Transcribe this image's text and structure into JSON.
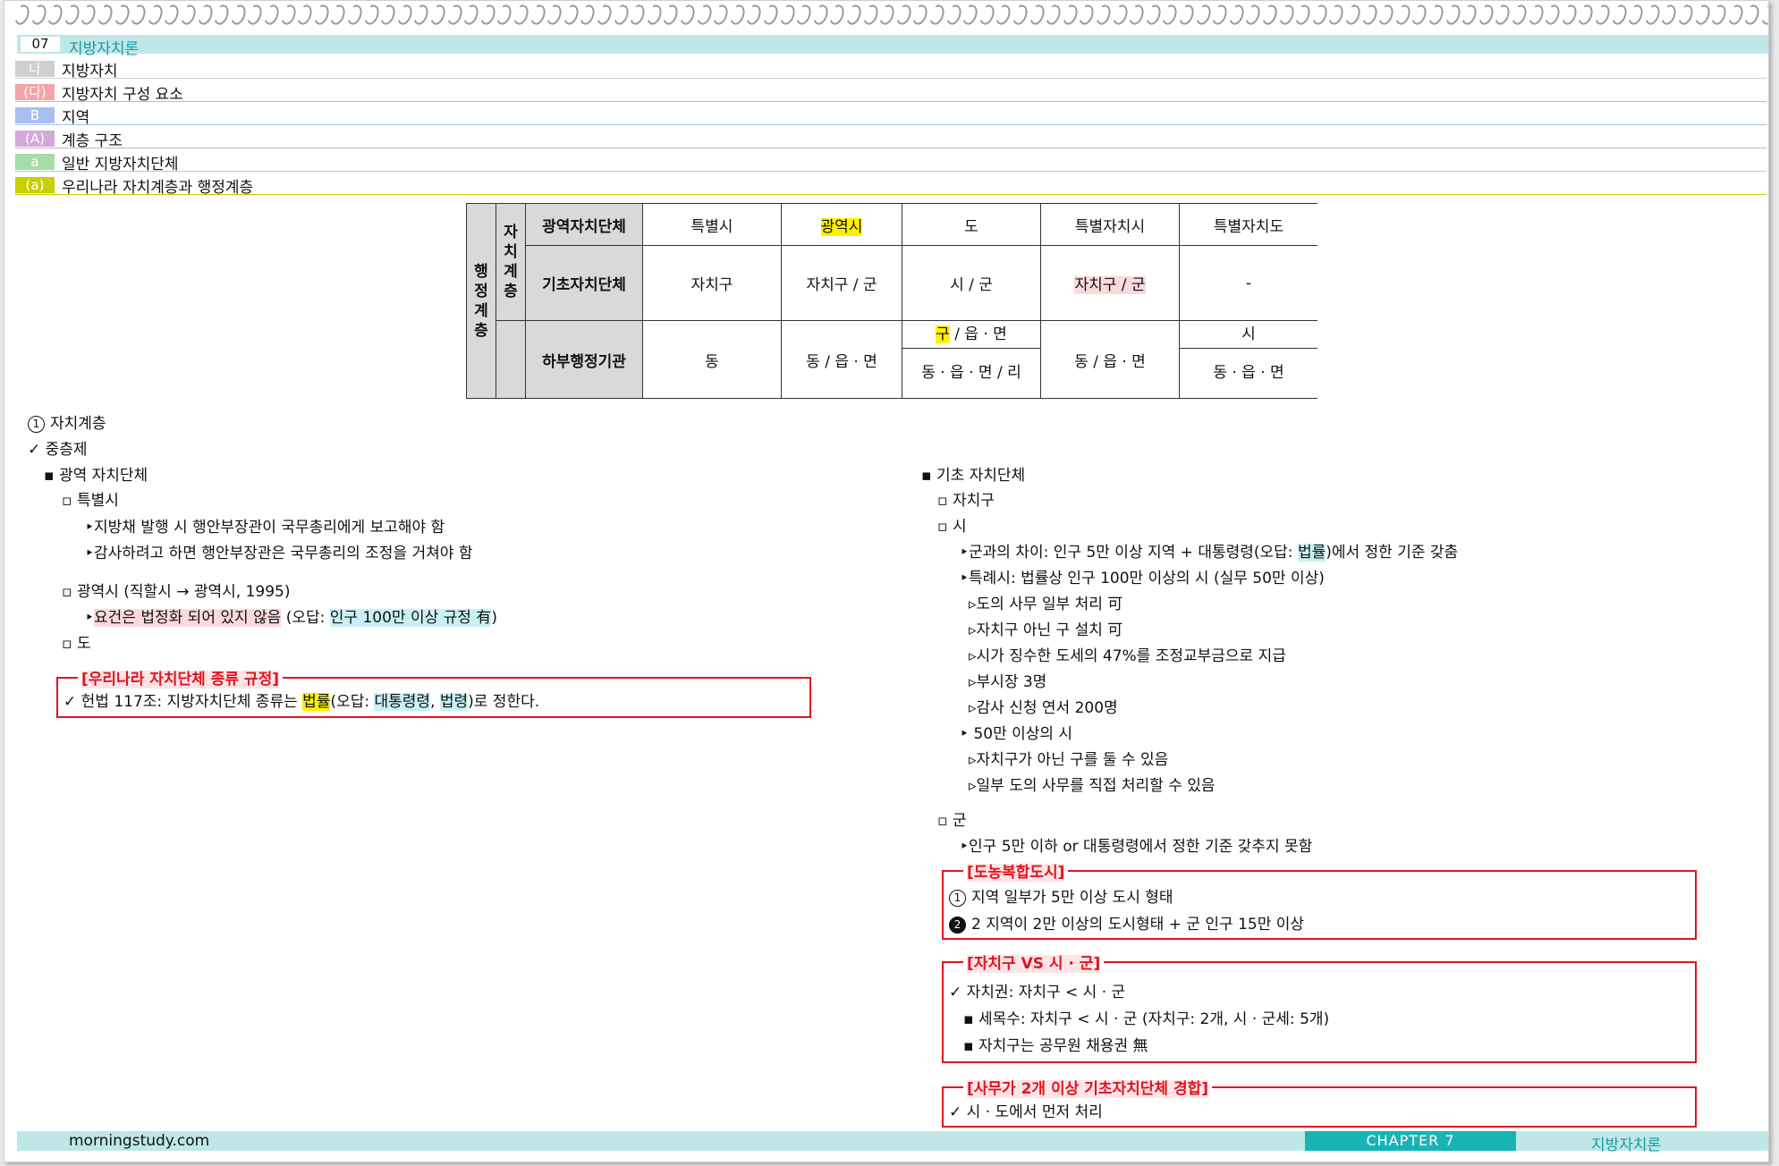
{
  "chapter_num": "07",
  "chapter_title": "지방자치론",
  "headers": [
    {
      "tag": "나",
      "text": "지방자치",
      "color": "#cfcfcf"
    },
    {
      "tag": "(다)",
      "text": "지방자치 구성 요소",
      "color": "#f4a3a8"
    },
    {
      "tag": "B",
      "text": "지역",
      "color": "#a9bff0"
    },
    {
      "tag": "(A)",
      "text": "계층 구조",
      "color": "#d3a9dc"
    },
    {
      "tag": "a",
      "text": "일반 지방자치단체",
      "color": "#a6dba8"
    },
    {
      "tag": "(a)",
      "text": "우리나라 자치계층과 행정계층",
      "color": "#c9cf00"
    }
  ],
  "table": {
    "row_head_outer": "행\n정\n계\n층",
    "row_head_inner": "자\n치\n계\n층",
    "r1_label": "광역자치단체",
    "r1": [
      "특별시",
      "광역시",
      "도",
      "특별자치시",
      "특별자치도"
    ],
    "r2_label": "기초자치단체",
    "r2": [
      "자치구",
      "자치구 / 군",
      "시 / 군",
      "자치구 / 군",
      "-"
    ],
    "r3_label": "하부행정기관",
    "r3_c1": "동",
    "r3_c2": "동 / 읍 · 면",
    "r3_c3_top_hl": "구",
    "r3_c3_top_rest": " / 읍 · 면",
    "r3_c3_bottom": "동 · 읍 · 면 / 리",
    "r3_c4": "동 / 읍 · 면",
    "r3_c5_top": "시",
    "r3_c5_bottom": "동 · 읍 · 면"
  },
  "left": {
    "section": "자치계층",
    "section_num": "1",
    "check1": "중층제",
    "l1": "광역 자치단체",
    "l2a": "특별시",
    "l3a": "지방채 발행 시 행안부장관이 국무총리에게 보고해야 함",
    "l3b": "감사하려고 하면 행안부장관은 국무총리의 조정을 거쳐야 함",
    "l2b": "광역시 (직할시 → 광역시, 1995)",
    "l3c_hl": "요건은 법정화 되어 있지 않음",
    "l3c_mid": " (오답: ",
    "l3c_hl2": "인구 100만 이상 규정 有",
    "l3c_end": ")",
    "l2c": "도",
    "box_title": "[우리나라 자치단체 종류 규정]",
    "box_pre": "헌법 117조: 지방자치단체 종류는 ",
    "box_hl1": "법률",
    "box_mid": "(오답: ",
    "box_hl2": "대통령령",
    "box_comma": ", ",
    "box_hl3": "법령",
    "box_end": ")로 정한다."
  },
  "right": {
    "l1": "기초 자치단체",
    "l2a": "자치구",
    "l2b": "시",
    "l3a_pre": "군과의 차이: 인구 5만 이상 지역 + 대통령령(오답: ",
    "l3a_hl": "법률",
    "l3a_end": ")에서 정한 기준 갖춤",
    "l3b": "특례시: 법률상 인구 100만 이상의 시 (실무 50만 이상)",
    "l4a": "도의 사무 일부 처리 可",
    "l4b": "자치구 아닌 구 설치 可",
    "l4c": "시가 징수한 도세의 47%를 조정교부금으로 지급",
    "l4d": "부시장 3명",
    "l4e": "감사 신청 연서 200명",
    "l3c": "50만 이상의 시",
    "l4f": "자치구가 아닌 구를 둘 수 있음",
    "l4g": "일부 도의 사무를 직접 처리할 수 있음",
    "l2c": "군",
    "l3d": "인구 5만 이하 or 대통령령에서 정한 기준 갖추지 못함",
    "box1_title": "[도농복합도시]",
    "box1_a_num": "1",
    "box1_a": "지역 일부가 5만 이상 도시 형태",
    "box1_b_num": "2",
    "box1_b": "2 지역이 2만 이상의 도시형태 + 군 인구 15만 이상",
    "box2_title": "[자치구 VS 시 · 군]",
    "box2_a": "자치권: 자치구 < 시 · 군",
    "box2_b": "세목수: 자치구 < 시 · 군 (자치구: 2개, 시 · 군세: 5개)",
    "box2_c": "자치구는 공무원 채용권 無",
    "box3_title": "[사무가 2개 이상 기초자치단체 경합]",
    "box3_a": "시 · 도에서 먼저 처리"
  },
  "footer": {
    "site": "morningstudy.com",
    "chapter": "CHAPTER 7",
    "subject": "지방자치론"
  },
  "glyphs": {
    "check": "✓",
    "bullet": "▪",
    "hollow": "▫",
    "tri": "‣",
    "small_tri": "▹"
  }
}
